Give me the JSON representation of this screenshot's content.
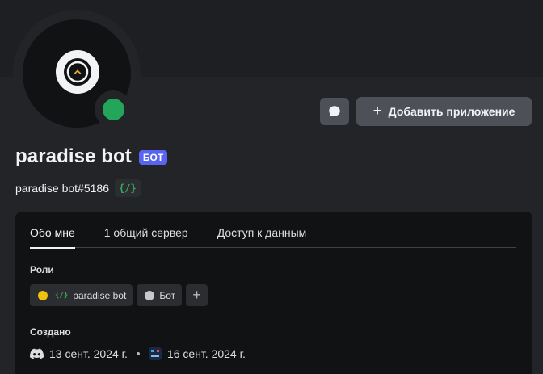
{
  "profile": {
    "display_name": "paradise bot",
    "bot_badge": "БОТ",
    "username": "paradise bot#5186",
    "dev_badge": "{/}",
    "status_color": "#23a55a"
  },
  "actions": {
    "message_icon": "chat-bubble-icon",
    "add_app_plus": "+",
    "add_app_label": "Добавить приложение"
  },
  "tabs": [
    {
      "label": "Обо мне",
      "active": true
    },
    {
      "label": "1 общий сервер",
      "active": false
    },
    {
      "label": "Доступ к данным",
      "active": false
    }
  ],
  "roles_section": {
    "title": "Роли",
    "roles": [
      {
        "color": "#f0c20c",
        "icon": "{/}",
        "label": "paradise bot"
      },
      {
        "color": "#c7c9cc",
        "label": "Бот"
      }
    ],
    "add_label": "+"
  },
  "created_section": {
    "title": "Создано",
    "discord_date": "13 сент. 2024 г.",
    "server_date": "16 сент. 2024 г."
  }
}
